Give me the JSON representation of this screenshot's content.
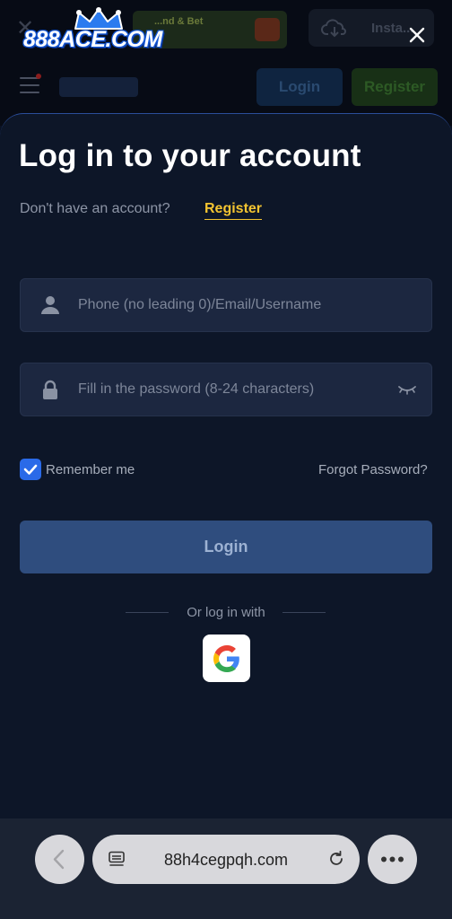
{
  "background": {
    "brand": "888ACE.COM",
    "promo_text": "...nd & Bet",
    "install_label": "Insta...",
    "login_label": "Login",
    "register_label": "Register"
  },
  "modal": {
    "title": "Log in to your account",
    "no_account_text": "Don't have an account?",
    "register_link": "Register",
    "username_placeholder": "Phone (no leading 0)/Email/Username",
    "password_placeholder": "Fill in the password (8-24 characters)",
    "remember_label": "Remember me",
    "remember_checked": true,
    "forgot_label": "Forgot Password?",
    "login_button": "Login",
    "or_login_with": "Or log in with"
  },
  "browser": {
    "url": "88h4cegpqh.com"
  },
  "colors": {
    "accent_yellow": "#f4c431",
    "checkbox_blue": "#2a6ae8",
    "login_button": "#2f4d7e",
    "sheet_bg": "#0d1628"
  },
  "icons": {
    "user": "user-icon",
    "lock": "lock-icon",
    "eye": "eye-closed-icon",
    "google": "google-icon",
    "close": "close-icon",
    "back": "chevron-left-icon",
    "reload": "reload-icon",
    "more": "more-icon"
  }
}
